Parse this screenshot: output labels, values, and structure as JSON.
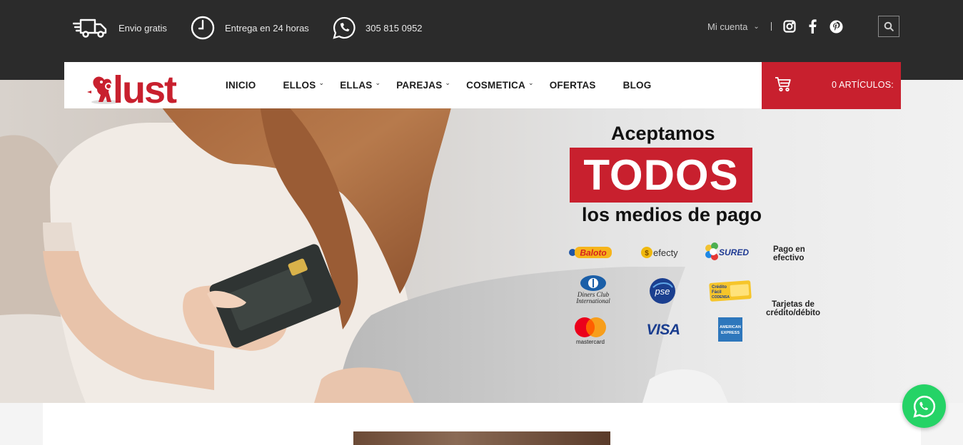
{
  "topbar": {
    "shipping_label": "Envio gratis",
    "delivery_label": "Entrega en 24 horas",
    "phone_label": "305 815 0952",
    "account_label": "Mi cuenta"
  },
  "brand": {
    "name": "lust",
    "color": "#c8202e"
  },
  "nav": {
    "items": [
      {
        "label": "INICIO"
      },
      {
        "label": "ELLOS"
      },
      {
        "label": "ELLAS"
      },
      {
        "label": "PAREJAS"
      },
      {
        "label": "COSMETICA"
      },
      {
        "label": "OFERTAS"
      },
      {
        "label": "BLOG"
      }
    ],
    "cart_label": "0 ARTÍCULOS:"
  },
  "hero": {
    "line1": "Aceptamos",
    "line2": "TODOS",
    "line3": "los medios de pago",
    "cash_label_1": "Pago en",
    "cash_label_2": "efectivo",
    "card_label_1": "Tarjetas de",
    "card_label_2": "crédito/débito",
    "logos": {
      "baloto": "Baloto",
      "efecty": "efecty",
      "sured": "SURED",
      "diners_1": "Diners Club",
      "diners_2": "International",
      "pse": "pse",
      "codensa_1": "Crédito",
      "codensa_2": "Fácil",
      "codensa_3": "CODENSA",
      "mastercard": "mastercard",
      "visa": "VISA",
      "amex_1": "AMERICAN",
      "amex_2": "EXPRESS"
    }
  },
  "colors": {
    "topbar": "#2b2b2b",
    "accent": "#c8202e",
    "whatsapp": "#25d366"
  }
}
